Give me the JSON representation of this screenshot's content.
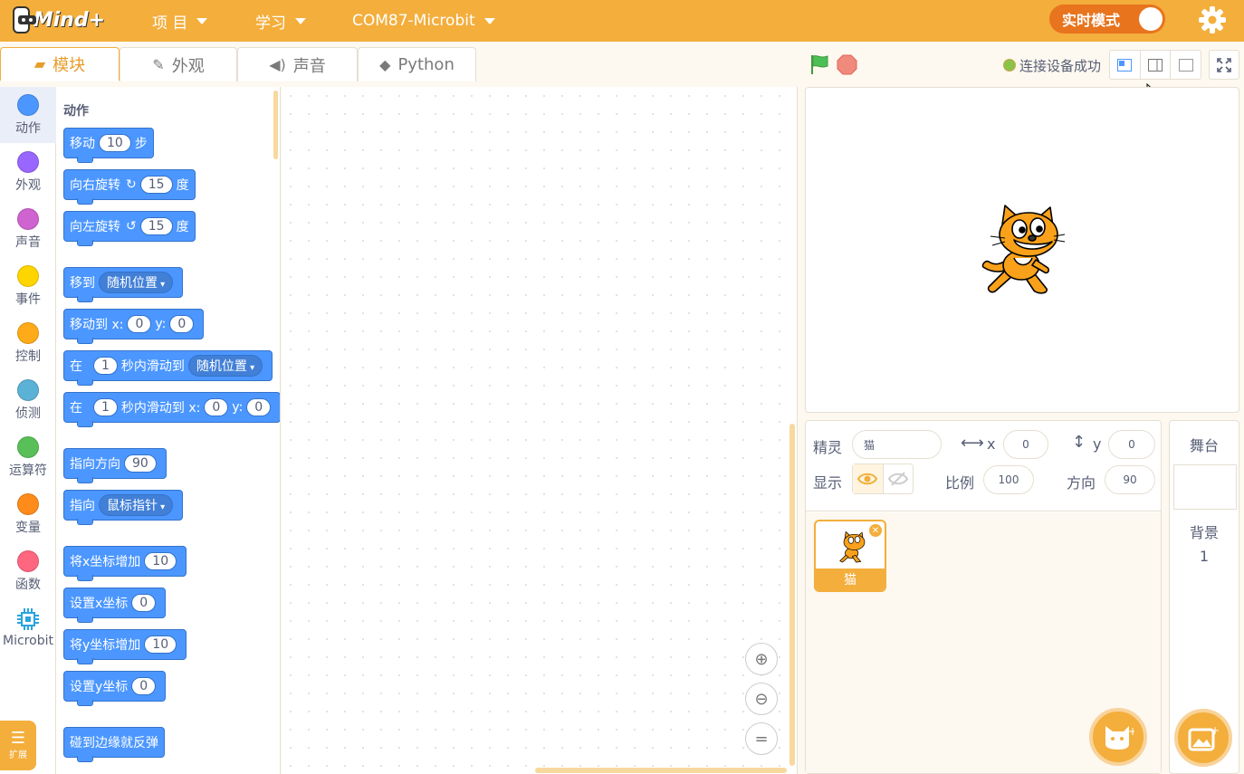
{
  "app": {
    "logo_text": "Mind+"
  },
  "menu": {
    "project": "项 目",
    "learn": "学习",
    "device": "COM87-Microbit"
  },
  "realtime_label": "实时模式",
  "tabs": [
    {
      "label": "模块",
      "icon": "blocks-icon"
    },
    {
      "label": "外观",
      "icon": "brush-icon"
    },
    {
      "label": "声音",
      "icon": "speaker-icon"
    },
    {
      "label": "Python",
      "icon": "python-icon"
    }
  ],
  "categories": [
    {
      "label": "动作",
      "color": "#4c97ff"
    },
    {
      "label": "外观",
      "color": "#9966ff"
    },
    {
      "label": "声音",
      "color": "#cf63cf"
    },
    {
      "label": "事件",
      "color": "#ffd500"
    },
    {
      "label": "控制",
      "color": "#ffab19"
    },
    {
      "label": "侦测",
      "color": "#5cb1d6"
    },
    {
      "label": "运算符",
      "color": "#59c059"
    },
    {
      "label": "变量",
      "color": "#ff8c1a"
    },
    {
      "label": "函数",
      "color": "#ff6680"
    },
    {
      "label": "Microbit",
      "color": "#29a3e0"
    }
  ],
  "extension_label": "扩展",
  "palette": {
    "title": "动作",
    "move": {
      "a": "移动",
      "v": "10",
      "b": "步"
    },
    "turn_right": {
      "a": "向右旋转",
      "v": "15",
      "b": "度"
    },
    "turn_left": {
      "a": "向左旋转",
      "v": "15",
      "b": "度"
    },
    "goto": {
      "a": "移到",
      "dd": "随机位置"
    },
    "goto_xy": {
      "a": "移动到 x:",
      "x": "0",
      "b": "y:",
      "y": "0"
    },
    "glide_to": {
      "a": "在",
      "v": "1",
      "b": "秒内滑动到",
      "dd": "随机位置"
    },
    "glide_xy": {
      "a": "在",
      "v": "1",
      "b": "秒内滑动到 x:",
      "x": "0",
      "c": "y:",
      "y": "0"
    },
    "point_dir": {
      "a": "指向方向",
      "v": "90"
    },
    "point_to": {
      "a": "指向",
      "dd": "鼠标指针"
    },
    "change_x": {
      "a": "将x坐标增加",
      "v": "10"
    },
    "set_x": {
      "a": "设置x坐标",
      "v": "0"
    },
    "change_y": {
      "a": "将y坐标增加",
      "v": "10"
    },
    "set_y": {
      "a": "设置y坐标",
      "v": "0"
    },
    "bounce": {
      "a": "碰到边缘就反弹"
    }
  },
  "connection": "连接设备成功",
  "sprite": {
    "label": "精灵",
    "name": "猫",
    "x_label": "x",
    "x": "0",
    "y_label": "y",
    "y": "0",
    "show_label": "显示",
    "size_label": "比例",
    "size": "100",
    "dir_label": "方向",
    "direction": "90",
    "thumb_name": "猫"
  },
  "stage_panel": {
    "title": "舞台",
    "backdrop_label": "背景",
    "backdrop_count": "1"
  },
  "colors": {
    "accent": "#f3ae3c",
    "block_motion": "#4c97ff",
    "toggle": "#e8741e"
  }
}
